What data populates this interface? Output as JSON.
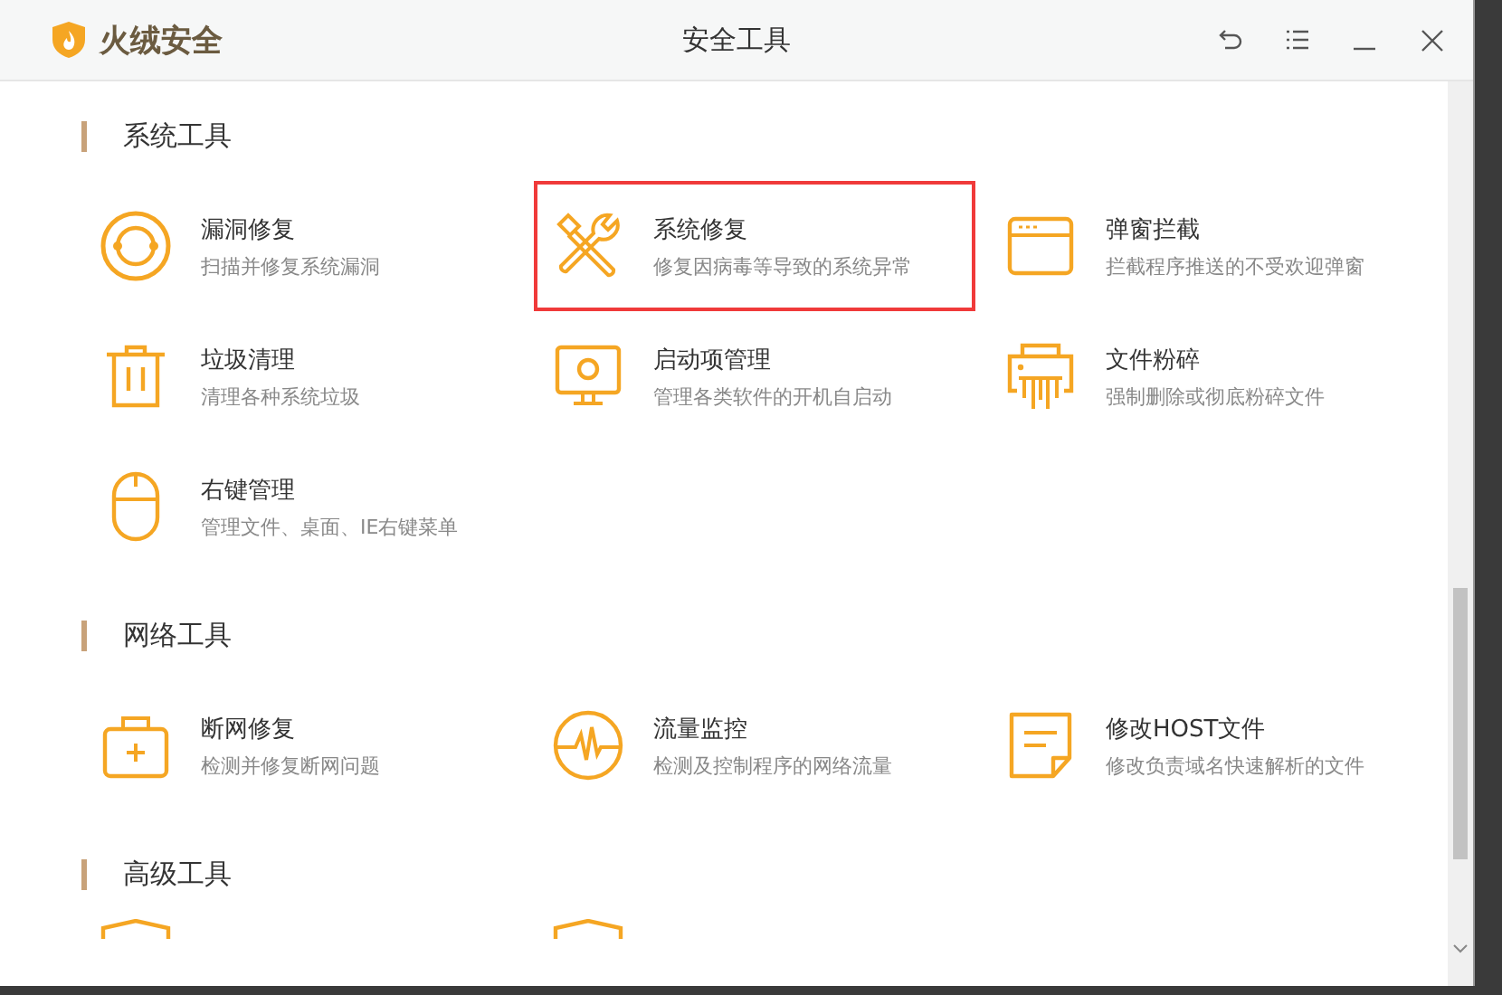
{
  "window": {
    "brand": "火绒安全",
    "title": "安全工具"
  },
  "sections": [
    {
      "title": "系统工具",
      "items": [
        {
          "name": "漏洞修复",
          "description": "扫描并修复系统漏洞",
          "highlighted": false
        },
        {
          "name": "系统修复",
          "description": "修复因病毒等导致的系统异常",
          "highlighted": true
        },
        {
          "name": "弹窗拦截",
          "description": "拦截程序推送的不受欢迎弹窗",
          "highlighted": false
        },
        {
          "name": "垃圾清理",
          "description": "清理各种系统垃圾",
          "highlighted": false
        },
        {
          "name": "启动项管理",
          "description": "管理各类软件的开机自启动",
          "highlighted": false
        },
        {
          "name": "文件粉碎",
          "description": "强制删除或彻底粉碎文件",
          "highlighted": false
        },
        {
          "name": "右键管理",
          "description": "管理文件、桌面、IE右键菜单",
          "highlighted": false
        }
      ]
    },
    {
      "title": "网络工具",
      "items": [
        {
          "name": "断网修复",
          "description": "检测并修复断网问题",
          "highlighted": false
        },
        {
          "name": "流量监控",
          "description": "检测及控制程序的网络流量",
          "highlighted": false
        },
        {
          "name": "修改HOST文件",
          "description": "修改负责域名快速解析的文件",
          "highlighted": false
        }
      ]
    },
    {
      "title": "高级工具"
    }
  ]
}
